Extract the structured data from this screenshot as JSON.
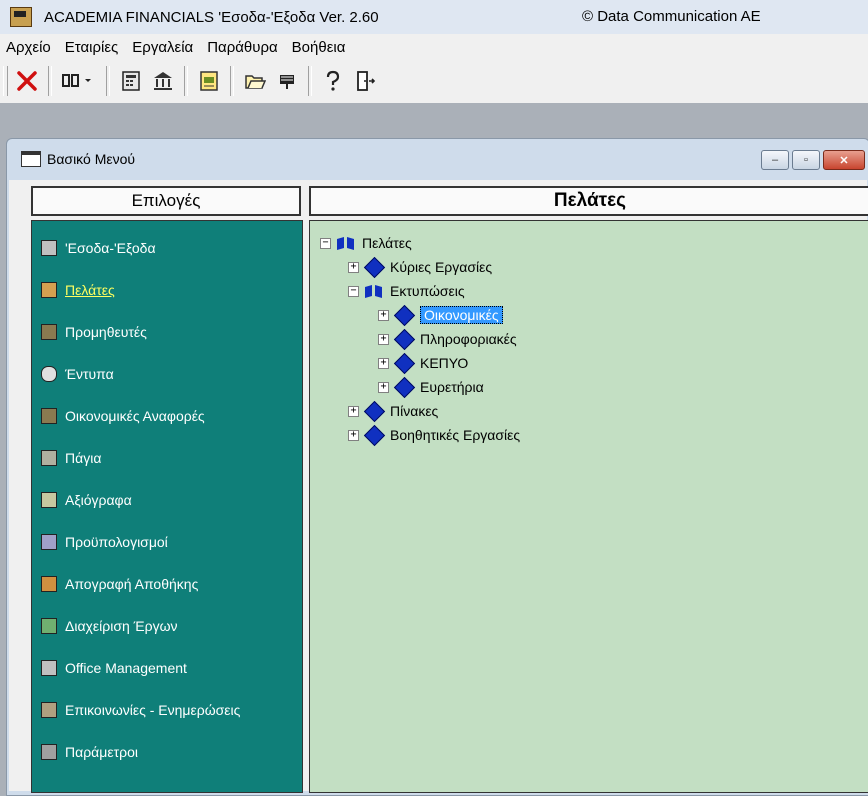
{
  "titlebar": {
    "title": "ACADEMIA FINANCIALS 'Εσοδα-'Εξοδα Ver. 2.60",
    "copyright": "© Data Communication AE"
  },
  "menubar": {
    "items": [
      "Αρχείο",
      "Εταιρίες",
      "Εργαλεία",
      "Παράθυρα",
      "Βοήθεια"
    ]
  },
  "toolbar": {
    "icons": [
      "close-icon",
      "columns-dropdown-icon",
      "calculator-icon",
      "bank-icon",
      "report-icon",
      "folder-open-icon",
      "flag-icon",
      "help-icon",
      "exit-door-icon"
    ]
  },
  "child_window": {
    "title": "Βασικό Μενού",
    "minimize": "‒",
    "maximize": "▫",
    "close": "✕"
  },
  "left_header": "Επιλογές",
  "right_header": "Πελάτες",
  "nav": [
    {
      "label": "'Εσοδα-'Εξοδα",
      "icon": "ledger-icon"
    },
    {
      "label": "Πελάτες",
      "icon": "customer-icon"
    },
    {
      "label": "Προμηθευτές",
      "icon": "supplier-icon"
    },
    {
      "label": "Έντυπα",
      "icon": "forms-icon"
    },
    {
      "label": "Οικονομικές Αναφορές",
      "icon": "financial-reports-icon"
    },
    {
      "label": "Πάγια",
      "icon": "fixed-assets-icon"
    },
    {
      "label": "Αξιόγραφα",
      "icon": "securities-icon"
    },
    {
      "label": "Προϋπολογισμοί",
      "icon": "budget-icon"
    },
    {
      "label": "Απογραφή Αποθήκης",
      "icon": "inventory-icon"
    },
    {
      "label": "Διαχείριση Έργων",
      "icon": "projects-icon"
    },
    {
      "label": "Office Management",
      "icon": "office-icon"
    },
    {
      "label": "Επικοινωνίες - Ενημερώσεις",
      "icon": "communications-icon"
    },
    {
      "label": "Παράμετροι",
      "icon": "parameters-icon"
    }
  ],
  "active_nav": "Πελάτες",
  "tree": {
    "root": "Πελάτες",
    "n1": "Κύριες Εργασίες",
    "n2": "Εκτυπώσεις",
    "n2a": "Οικονομικές",
    "n2b": "Πληροφοριακές",
    "n2c": "ΚΕΠΥΟ",
    "n2d": "Ευρετήρια",
    "n3": "Πίνακες",
    "n4": "Βοηθητικές Εργασίες",
    "selected": "Οικονομικές",
    "expand": "+",
    "collapse": "−"
  }
}
